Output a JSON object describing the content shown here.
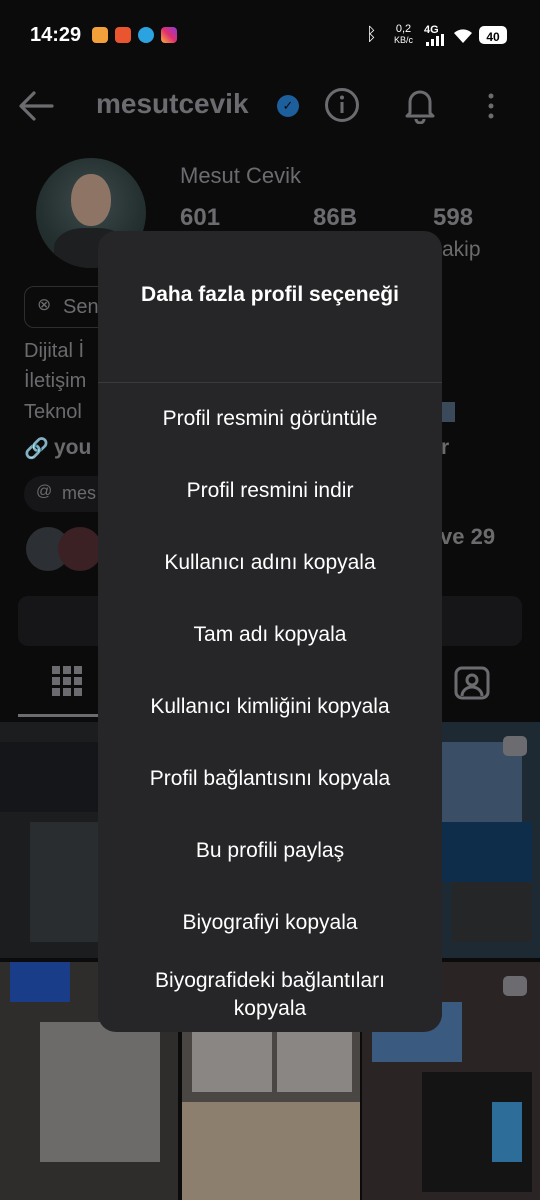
{
  "status_bar": {
    "time": "14:29",
    "speed_value": "0,2",
    "speed_unit": "KB/с",
    "network": "4G",
    "battery": "40"
  },
  "profile": {
    "username": "mesutcevik",
    "full_name": "Mesut Cevik",
    "stats": [
      "601",
      "86B",
      "598"
    ],
    "following_label_partial": "akip",
    "button_partial": "Sen",
    "bio_partial": [
      "Dijital İ",
      "İletişim",
      "Teknol"
    ],
    "link_partial": "you",
    "link_suffix": "r",
    "threads_partial": "mes",
    "followers_suffix": "ve 29"
  },
  "modal": {
    "title": "Daha fazla profil seçeneği",
    "options": [
      "Profil resmini görüntüle",
      "Profil resmini indir",
      "Kullanıcı adını kopyala",
      "Tam adı kopyala",
      "Kullanıcı kimliğini kopyala",
      "Profil bağlantısını kopyala",
      "Bu profili paylaş",
      "Biyografiyi kopyala",
      "Biyografideki bağlantıları kopyala"
    ]
  },
  "icons": {
    "back": "back-arrow-icon",
    "info": "info-icon",
    "bell": "bell-icon",
    "more": "more-vertical-icon"
  },
  "colors": {
    "background": "#0b0b0c",
    "modal": "#262628",
    "verified": "#1d5f9c",
    "dim_text": "#6c6c70"
  }
}
